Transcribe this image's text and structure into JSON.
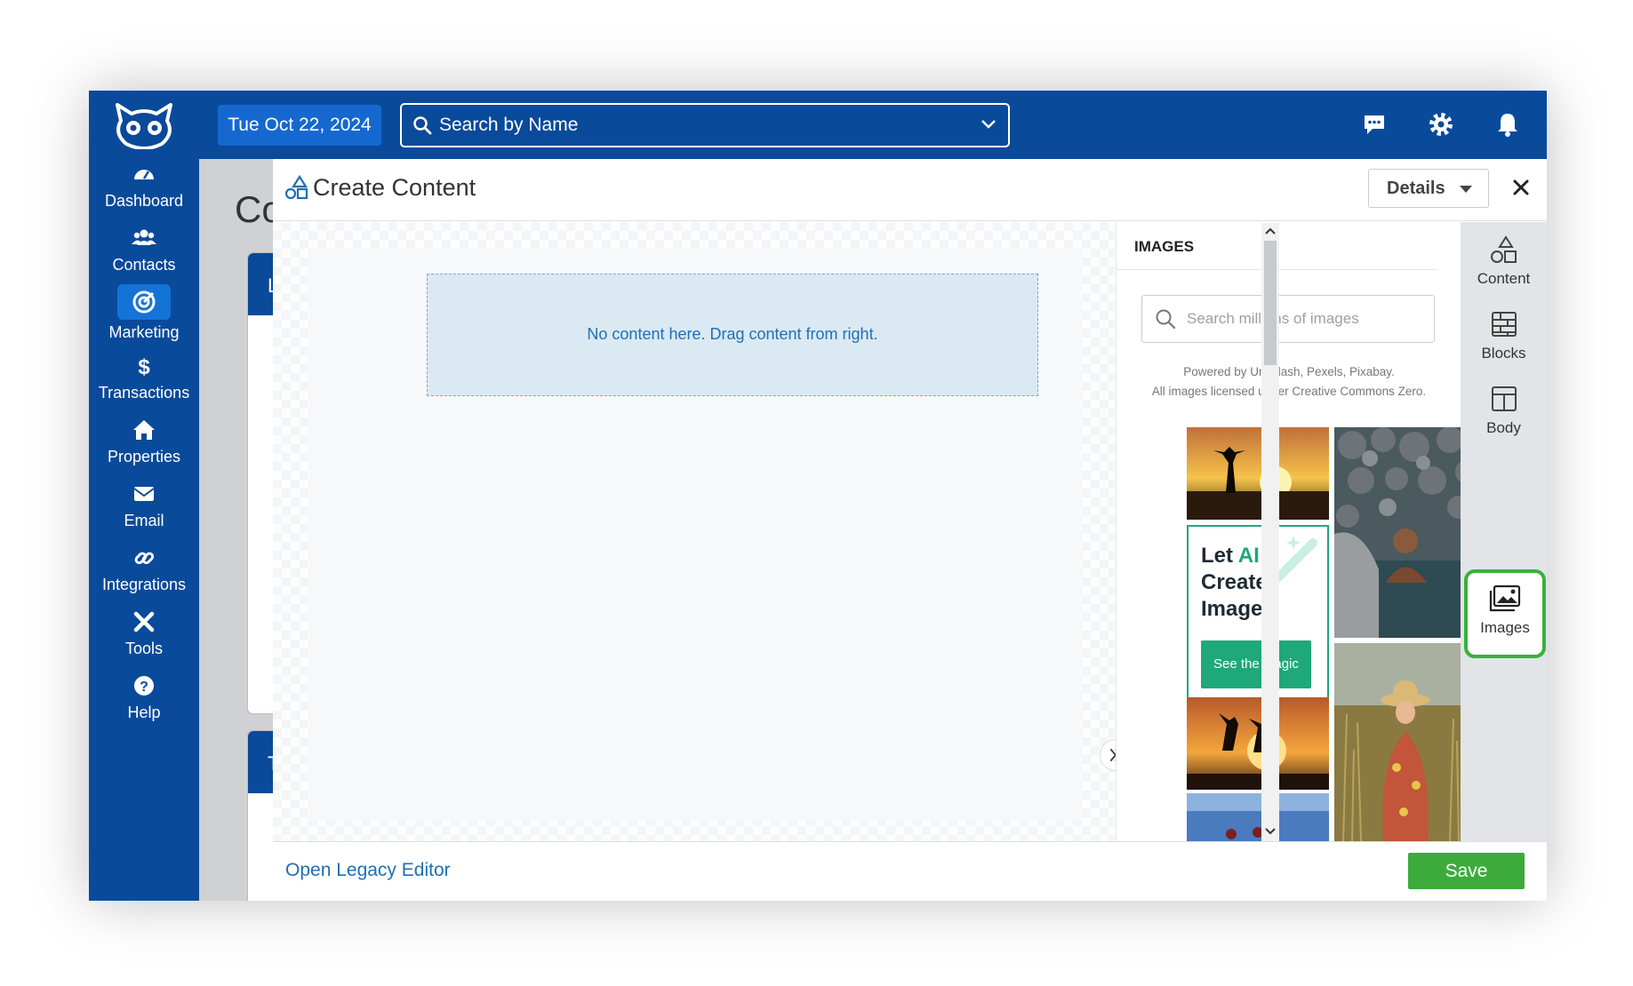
{
  "sidebar": {
    "items": [
      {
        "label": "Dashboard",
        "icon": "dashboard-icon"
      },
      {
        "label": "Contacts",
        "icon": "contacts-icon"
      },
      {
        "label": "Marketing",
        "icon": "marketing-icon",
        "active": true
      },
      {
        "label": "Transactions",
        "icon": "dollar-icon"
      },
      {
        "label": "Properties",
        "icon": "home-icon"
      },
      {
        "label": "Email",
        "icon": "envelope-icon"
      },
      {
        "label": "Integrations",
        "icon": "link-icon"
      },
      {
        "label": "Tools",
        "icon": "tools-icon"
      },
      {
        "label": "Help",
        "icon": "help-icon"
      }
    ]
  },
  "topbar": {
    "date": "Tue Oct 22, 2024",
    "search_placeholder": "Search by Name",
    "icons": [
      "chat-icon",
      "gear-icon",
      "bell-icon",
      "avatar"
    ]
  },
  "background_page": {
    "title_fragment": "Co",
    "card_letter_1": "L",
    "card_letter_2": "T"
  },
  "modal": {
    "title": "Create Content",
    "details_label": "Details",
    "drop_zone_text": "No content here. Drag content from right.",
    "toolbar_icons": [
      "undo-icon",
      "redo-icon",
      "preview-eye-icon",
      "desktop-icon",
      "mobile-icon"
    ],
    "images_panel": {
      "heading": "IMAGES",
      "search_placeholder": "Search millions of images",
      "powered_line_1": "Powered by Unsplash, Pexels, Pixabay.",
      "powered_line_2": "All images licensed under Creative Commons Zero.",
      "ai_card": {
        "title_let": "Let",
        "title_ai": "AI",
        "title_rest_1": "Create",
        "title_rest_2": "Images",
        "button": "See the Magic"
      }
    },
    "rail": {
      "content": "Content",
      "blocks": "Blocks",
      "body": "Body",
      "images": "Images"
    },
    "footer": {
      "legacy_link": "Open Legacy Editor",
      "save": "Save"
    }
  },
  "colors": {
    "sidebar_bg": "#0a4a9b",
    "accent_blue": "#1668d1",
    "ai_green": "#1fa87a",
    "save_green": "#3dab3b",
    "highlight_green": "#36b23a"
  }
}
